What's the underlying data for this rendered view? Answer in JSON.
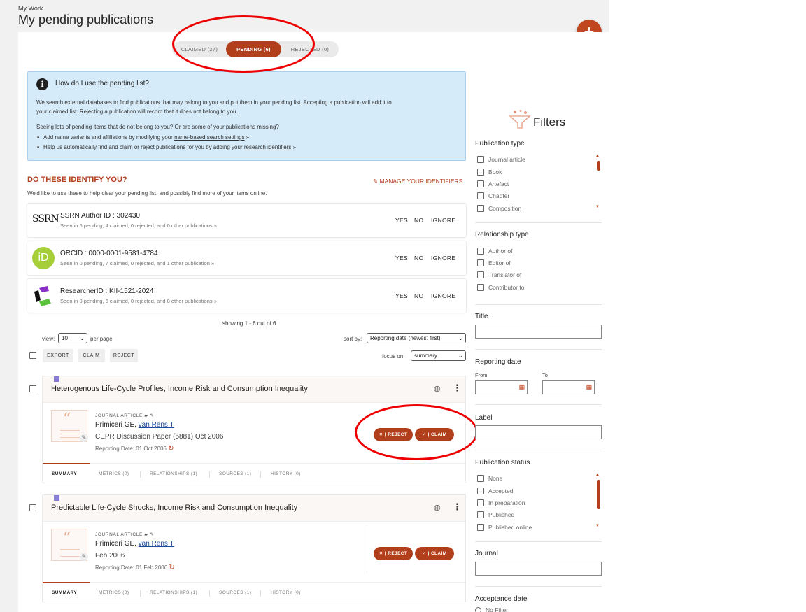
{
  "header": {
    "section": "My Work",
    "title": "My pending publications",
    "add_label": "+"
  },
  "tabs": [
    {
      "label": "CLAIMED (27)"
    },
    {
      "label": "PENDING (6)"
    },
    {
      "label": "REJECTED (0)"
    }
  ],
  "info": {
    "icon": "i",
    "title": "How do I use the pending list?",
    "p1": "We search external databases to find publications that may belong to you and put them in your pending list. Accepting a publication will add it to",
    "p1b": "your claimed list. Rejecting a publication will record that it does not belong to you.",
    "p2": "Seeing lots of pending items that do not belong to you? Or are some of your publications missing?",
    "b1_pre": "Add name variants and affiliations by modifying your ",
    "b1_link": "name-based search settings",
    "b1_post": " »",
    "b2_pre": "Help us automatically find and claim or reject publications for you by adding your ",
    "b2_link": "research identifiers",
    "b2_post": " »"
  },
  "identifiers": {
    "heading": "DO THESE IDENTIFY YOU?",
    "subtitle": "We'd like to use these to help clear your pending list, and possibly find more of your items online.",
    "manage": "MANAGE YOUR IDENTIFIERS",
    "yes": "YES",
    "no": "NO",
    "ignore": "IGNORE",
    "items": [
      {
        "logo": "SSRN",
        "title": "SSRN Author ID : 302430",
        "detail": "Seen in 6 pending, 4 claimed, 0 rejected, and 0 other publications »"
      },
      {
        "logo": "iD",
        "title": "ORCID : 0000-0001-9581-4784",
        "detail": "Seen in 0 pending, 7 claimed, 0 rejected, and 1 other publication »"
      },
      {
        "logo": "researcherid",
        "title": "ResearcherID : KII-1521-2024",
        "detail": "Seen in 0 pending, 6 claimed, 0 rejected, and 0 other publications »"
      }
    ]
  },
  "list": {
    "showing": "showing 1 - 6 out of 6",
    "view_label": "view:",
    "view_value": "10",
    "per_page": "per page",
    "sort_label": "sort by:",
    "sort_value": "Reporting date (newest first)",
    "focus_label": "focus on:",
    "focus_value": "summary",
    "export": "EXPORT",
    "claim": "CLAIM",
    "reject": "REJECT"
  },
  "publications": [
    {
      "title": "Heterogenous Life-Cycle Profiles, Income Risk and Consumption Inequality",
      "type": "JOURNAL ARTICLE",
      "authors": "Primiceri GE, ",
      "author_link": "van Rens T",
      "journal": "CEPR Discussion Paper (5881) Oct 2006",
      "reporting": "Reporting Date: 01 Oct 2006",
      "reject": "REJECT",
      "claim": "CLAIM",
      "tabs": [
        "SUMMARY",
        "METRICS (0)",
        "RELATIONSHIPS (1)",
        "SOURCES (1)",
        "HISTORY (0)"
      ]
    },
    {
      "title": "Predictable Life-Cycle Shocks, Income Risk and Consumption Inequality",
      "type": "JOURNAL ARTICLE",
      "authors": "Primiceri GE, ",
      "author_link": "van Rens T",
      "journal": "Feb 2006",
      "reporting": "Reporting Date: 01 Feb 2006",
      "reject": "REJECT",
      "claim": "CLAIM",
      "tabs": [
        "SUMMARY",
        "METRICS (0)",
        "RELATIONSHIPS (1)",
        "SOURCES (1)",
        "HISTORY (0)"
      ]
    }
  ],
  "filters": {
    "title": "Filters",
    "pub_type_h": "Publication type",
    "pub_types": [
      "Journal article",
      "Book",
      "Artefact",
      "Chapter",
      "Composition"
    ],
    "rel_type_h": "Relationship type",
    "rel_types": [
      "Author of",
      "Editor of",
      "Translator of",
      "Contributor to"
    ],
    "title_h": "Title",
    "reporting_h": "Reporting date",
    "from": "From",
    "to": "To",
    "label_h": "Label",
    "status_h": "Publication status",
    "statuses": [
      "None",
      "Accepted",
      "In preparation",
      "Published",
      "Published online"
    ],
    "journal_h": "Journal",
    "acceptance_h": "Acceptance date",
    "no_filter": "No Filter"
  }
}
